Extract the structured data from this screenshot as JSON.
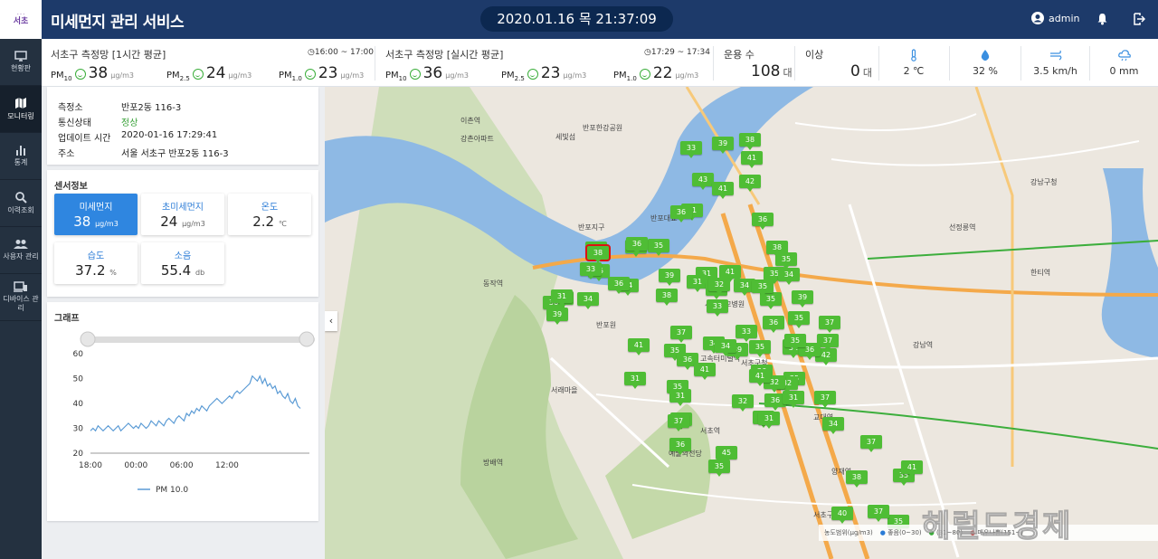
{
  "header": {
    "logo_text": "서초",
    "app_title": "미세먼지 관리 서비스",
    "clock": "2020.01.16 목 21:37:09",
    "user": "admin"
  },
  "sidebar": {
    "items": [
      {
        "label": "현황판",
        "icon": "monitor-icon"
      },
      {
        "label": "모니터링",
        "icon": "map-icon",
        "active": true
      },
      {
        "label": "통계",
        "icon": "bar-chart-icon"
      },
      {
        "label": "이력조회",
        "icon": "search-icon"
      },
      {
        "label": "사용자 관리",
        "icon": "users-icon"
      },
      {
        "label": "디바이스 관리",
        "icon": "devices-icon"
      }
    ]
  },
  "stats": {
    "hourly": {
      "title": "서초구 측정망 [1시간 평균]",
      "time": "16:00 ~ 17:00",
      "pm10": {
        "value": "38",
        "unit": "μg/m3"
      },
      "pm25": {
        "value": "24",
        "unit": "μg/m3"
      },
      "pm1": {
        "value": "23",
        "unit": "μg/m3"
      }
    },
    "realtime": {
      "title": "서초구 측정망 [실시간 평균]",
      "time": "17:29 ~ 17:34",
      "pm10": {
        "value": "36",
        "unit": "μg/m3"
      },
      "pm25": {
        "value": "23",
        "unit": "μg/m3"
      },
      "pm1": {
        "value": "22",
        "unit": "μg/m3"
      }
    },
    "operating": {
      "label": "운용 수",
      "value": "108",
      "unit": "대"
    },
    "abnormal": {
      "label": "이상",
      "value": "0",
      "unit": "대"
    },
    "weather": {
      "temperature": "2 ℃",
      "humidity": "32 %",
      "wind": "3.5 km/h",
      "rain": "0 mm"
    }
  },
  "station": {
    "rows": [
      {
        "key": "측정소",
        "value": "반포2동 116-3"
      },
      {
        "key": "통신상태",
        "value": "정상"
      },
      {
        "key": "업데이트 시간",
        "value": "2020-01-16 17:29:41"
      },
      {
        "key": "주소",
        "value": "서울 서초구 반포2동 116-3"
      }
    ],
    "status_color": "#3aa23a"
  },
  "sensors": {
    "title": "센서정보",
    "items": [
      {
        "name": "미세먼지",
        "value": "38",
        "unit": "μg/m3",
        "selected": true
      },
      {
        "name": "초미세먼지",
        "value": "24",
        "unit": "μg/m3"
      },
      {
        "name": "온도",
        "value": "2.2",
        "unit": "℃"
      },
      {
        "name": "습도",
        "value": "37.2",
        "unit": "%"
      },
      {
        "name": "소음",
        "value": "55.4",
        "unit": "db"
      }
    ]
  },
  "graph": {
    "title": "그래프",
    "legend": "PM 10.0"
  },
  "chart_data": {
    "type": "line",
    "x_ticks": [
      "18:00",
      "00:00",
      "06:00",
      "12:00"
    ],
    "ylim": [
      20,
      60
    ],
    "y_ticks": [
      20,
      30,
      40,
      50,
      60
    ],
    "series": [
      {
        "name": "PM 10.0",
        "color": "#5b9bd5",
        "values": [
          29,
          30,
          29,
          31,
          30,
          29,
          30,
          31,
          30,
          29,
          30,
          31,
          29,
          30,
          31,
          32,
          31,
          30,
          31,
          30,
          32,
          31,
          30,
          31,
          33,
          32,
          31,
          33,
          32,
          31,
          33,
          34,
          33,
          32,
          34,
          35,
          34,
          33,
          36,
          35,
          37,
          36,
          38,
          37,
          39,
          38,
          37,
          39,
          40,
          41,
          42,
          41,
          40,
          41,
          42,
          43,
          42,
          44,
          45,
          44,
          45,
          46,
          47,
          48,
          51,
          50,
          49,
          51,
          48,
          50,
          47,
          48,
          46,
          47,
          44,
          45,
          43,
          42,
          44,
          41,
          40,
          42,
          39,
          38
        ]
      }
    ]
  },
  "map": {
    "selected_marker": "38",
    "markers": [
      "39",
      "38",
      "33",
      "41",
      "43",
      "41",
      "42",
      "41",
      "36",
      "36",
      "35",
      "38",
      "36",
      "35",
      "39",
      "35",
      "31",
      "41",
      "34",
      "31",
      "35",
      "38",
      "33",
      "35",
      "41",
      "32",
      "35",
      "34",
      "36",
      "34",
      "39",
      "31",
      "33",
      "36",
      "36",
      "34",
      "39",
      "35",
      "36",
      "33",
      "34",
      "39",
      "34",
      "35",
      "35",
      "42",
      "36",
      "31",
      "37",
      "32",
      "41",
      "36",
      "37",
      "34",
      "32",
      "37",
      "41",
      "31",
      "35",
      "36",
      "35",
      "41",
      "31",
      "37",
      "45",
      "36",
      "35",
      "41",
      "36",
      "41",
      "37",
      "32",
      "35",
      "36",
      "31",
      "32",
      "31",
      "38",
      "35",
      "37",
      "35",
      "41",
      "37",
      "40",
      "35"
    ],
    "legend": {
      "label": "농도범위(μg/m3)",
      "good": "좋음(0~30)",
      "normal": "(31~80)",
      "bad": "매우나쁨(151~)"
    },
    "watermark": "헤럴드경제",
    "place_labels": [
      "이촌역",
      "강촌아파트",
      "반포한강공원",
      "세빛섬",
      "반포지구",
      "반포대교",
      "동작역",
      "서래마을",
      "반포원",
      "고속터미널역",
      "방배역",
      "서초역",
      "교대역",
      "강남역",
      "서울성모병원",
      "예술의전당",
      "서초구청",
      "양재역",
      "강남구청",
      "선정릉역",
      "한티역",
      "서초구"
    ]
  }
}
